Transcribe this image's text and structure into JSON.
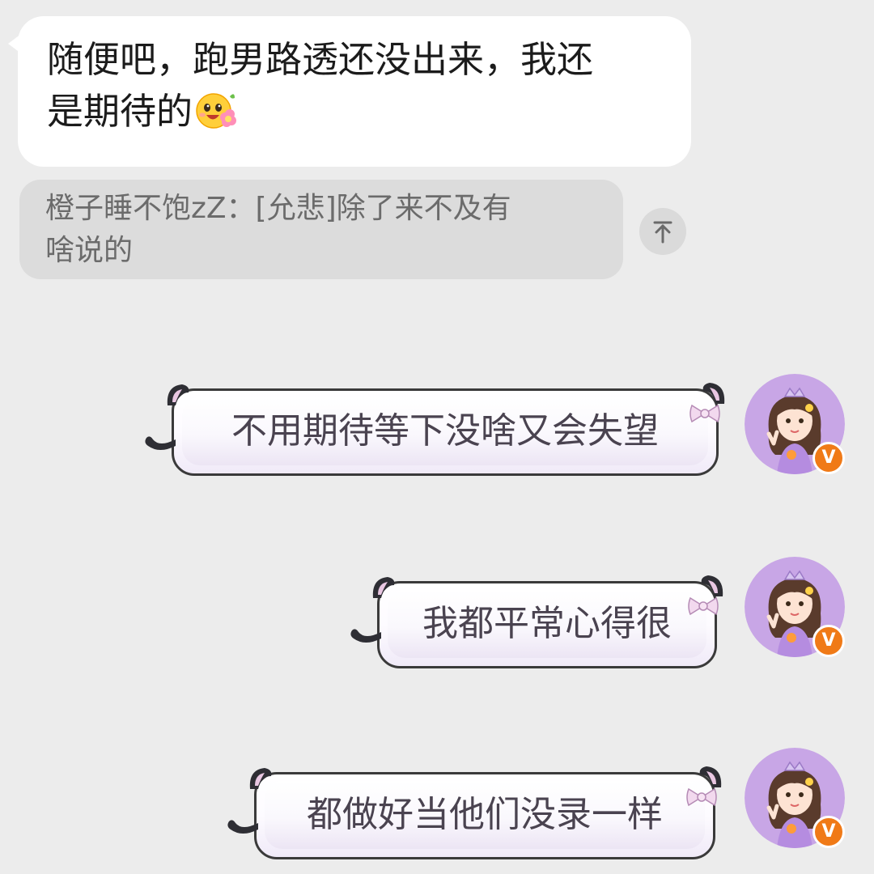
{
  "messages": [
    {
      "side": "left",
      "text_line1": "随便吧，跑男路透还没出来，我还",
      "text_line2": "是期待的",
      "emoji": "shy-smile-flower-emoji"
    }
  ],
  "quote": {
    "line1": "橙子睡不饱zZ：[允悲]除了来不及有",
    "line2": "啥说的"
  },
  "scroll_top_icon": "arrow-up-to-top-icon",
  "replies": [
    {
      "text": "不用期待等下没啥又会失望"
    },
    {
      "text": "我都平常心得很"
    },
    {
      "text": "都做好当他们没录一样"
    }
  ],
  "avatar": {
    "badge": "V",
    "badge_color": "#f07a17",
    "bg_color": "#c8a6e6"
  },
  "colors": {
    "background": "#ececec",
    "left_bubble": "#ffffff",
    "quote_bg": "#dcdcdc",
    "reply_text": "#4a4350"
  }
}
